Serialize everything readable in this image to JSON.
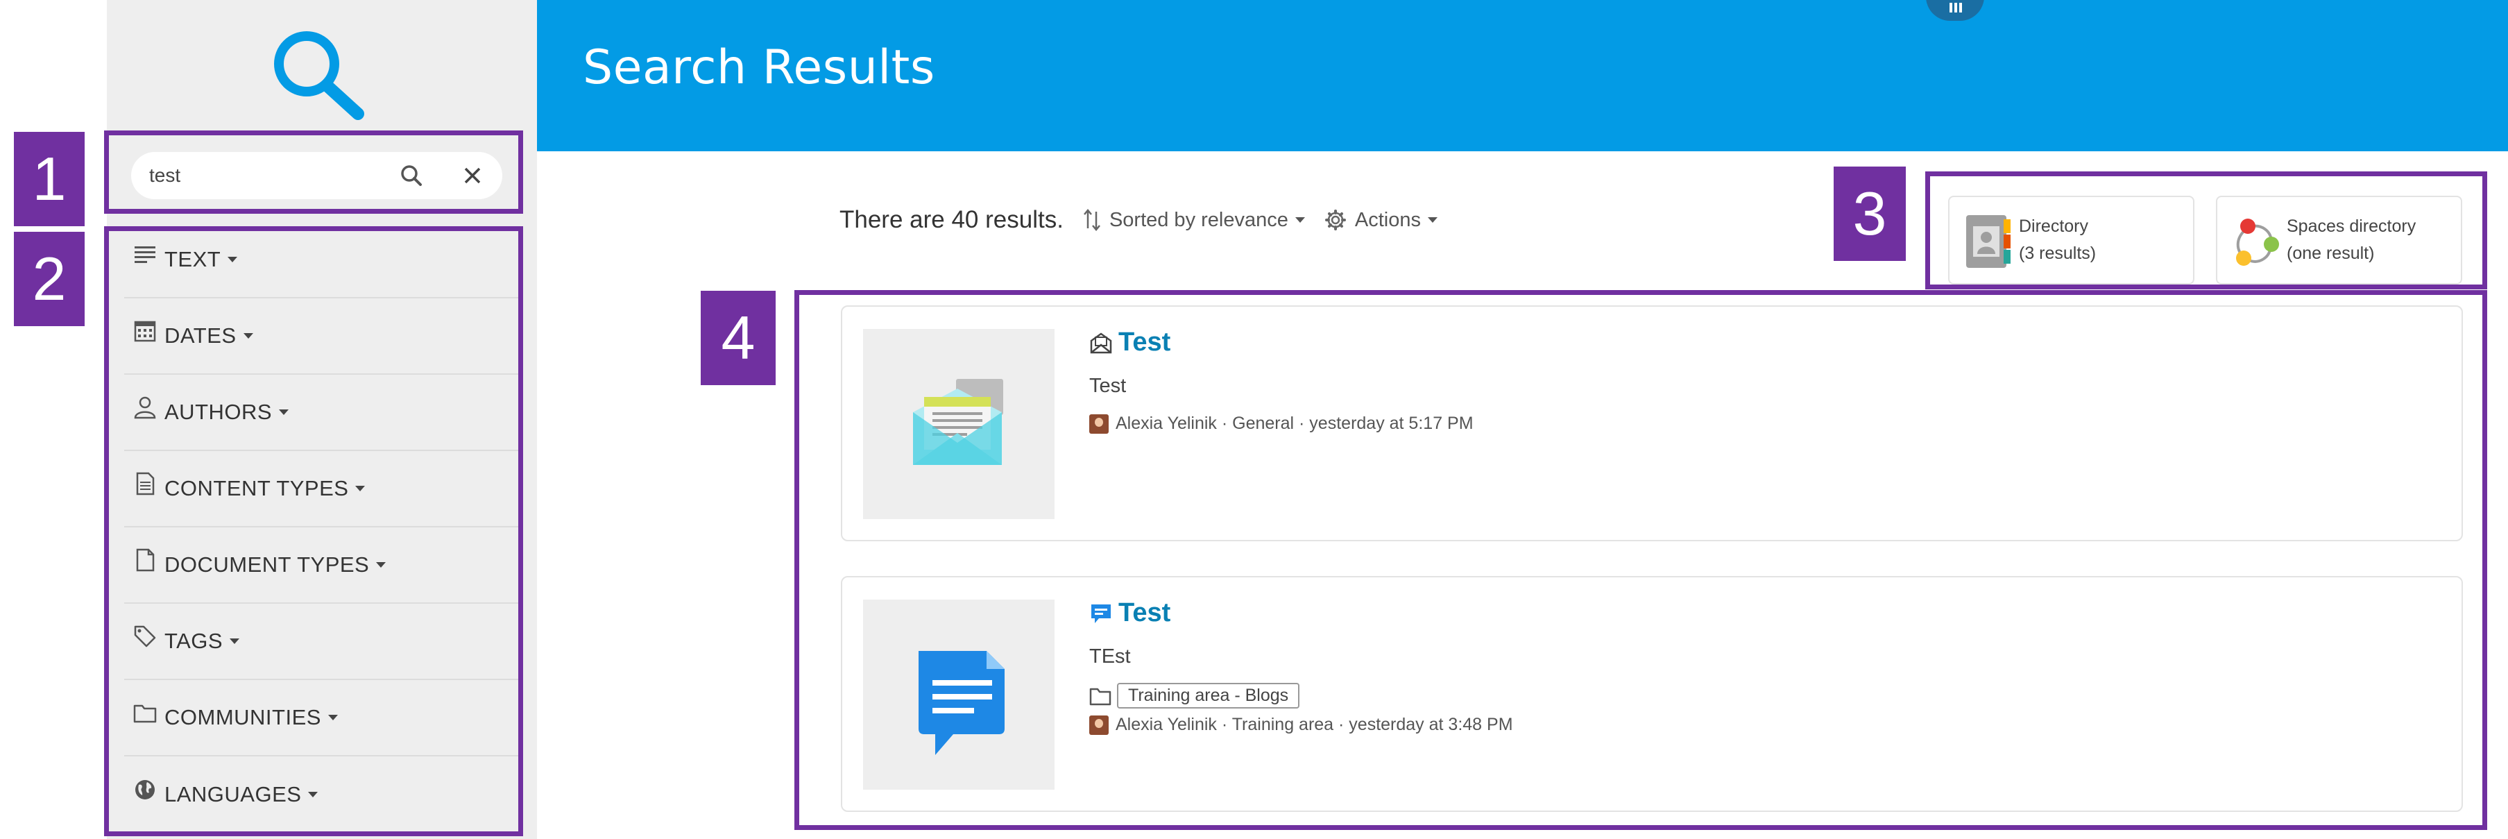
{
  "header": {
    "title": "Search Results"
  },
  "search": {
    "value": "test"
  },
  "facets": [
    {
      "label": "TEXT",
      "icon": "text-icon"
    },
    {
      "label": "DATES",
      "icon": "calendar-icon"
    },
    {
      "label": "AUTHORS",
      "icon": "person-icon"
    },
    {
      "label": "CONTENT TYPES",
      "icon": "document-icon"
    },
    {
      "label": "DOCUMENT TYPES",
      "icon": "file-icon"
    },
    {
      "label": "TAGS",
      "icon": "tag-icon"
    },
    {
      "label": "COMMUNITIES",
      "icon": "folder-icon"
    },
    {
      "label": "LANGUAGES",
      "icon": "globe-icon"
    }
  ],
  "results_bar": {
    "count_text": "There are 40 results.",
    "sort_label": "Sorted by relevance",
    "actions_label": "Actions"
  },
  "directories": [
    {
      "title": "Directory",
      "subtitle": "(3 results)",
      "icon": "contacts-book-icon"
    },
    {
      "title": "Spaces directory",
      "subtitle": "(one result)",
      "icon": "spaces-icon"
    }
  ],
  "results": [
    {
      "title": "Test",
      "type_icon": "newsletter-icon",
      "snippet": "Test",
      "meta": "Alexia Yelinik · General · yesterday at 5:17 PM"
    },
    {
      "title": "Test",
      "type_icon": "message-icon",
      "snippet": "TEst",
      "tag": "Training area - Blogs",
      "meta": "Alexia Yelinik · Training area · yesterday at 3:48 PM"
    }
  ],
  "annotations": [
    "1",
    "2",
    "3",
    "4"
  ],
  "colors": {
    "header_blue": "#039be5",
    "annotation_purple": "#7030a0",
    "title_link": "#0a80b3",
    "sidebar_bg": "#eeeeee"
  }
}
